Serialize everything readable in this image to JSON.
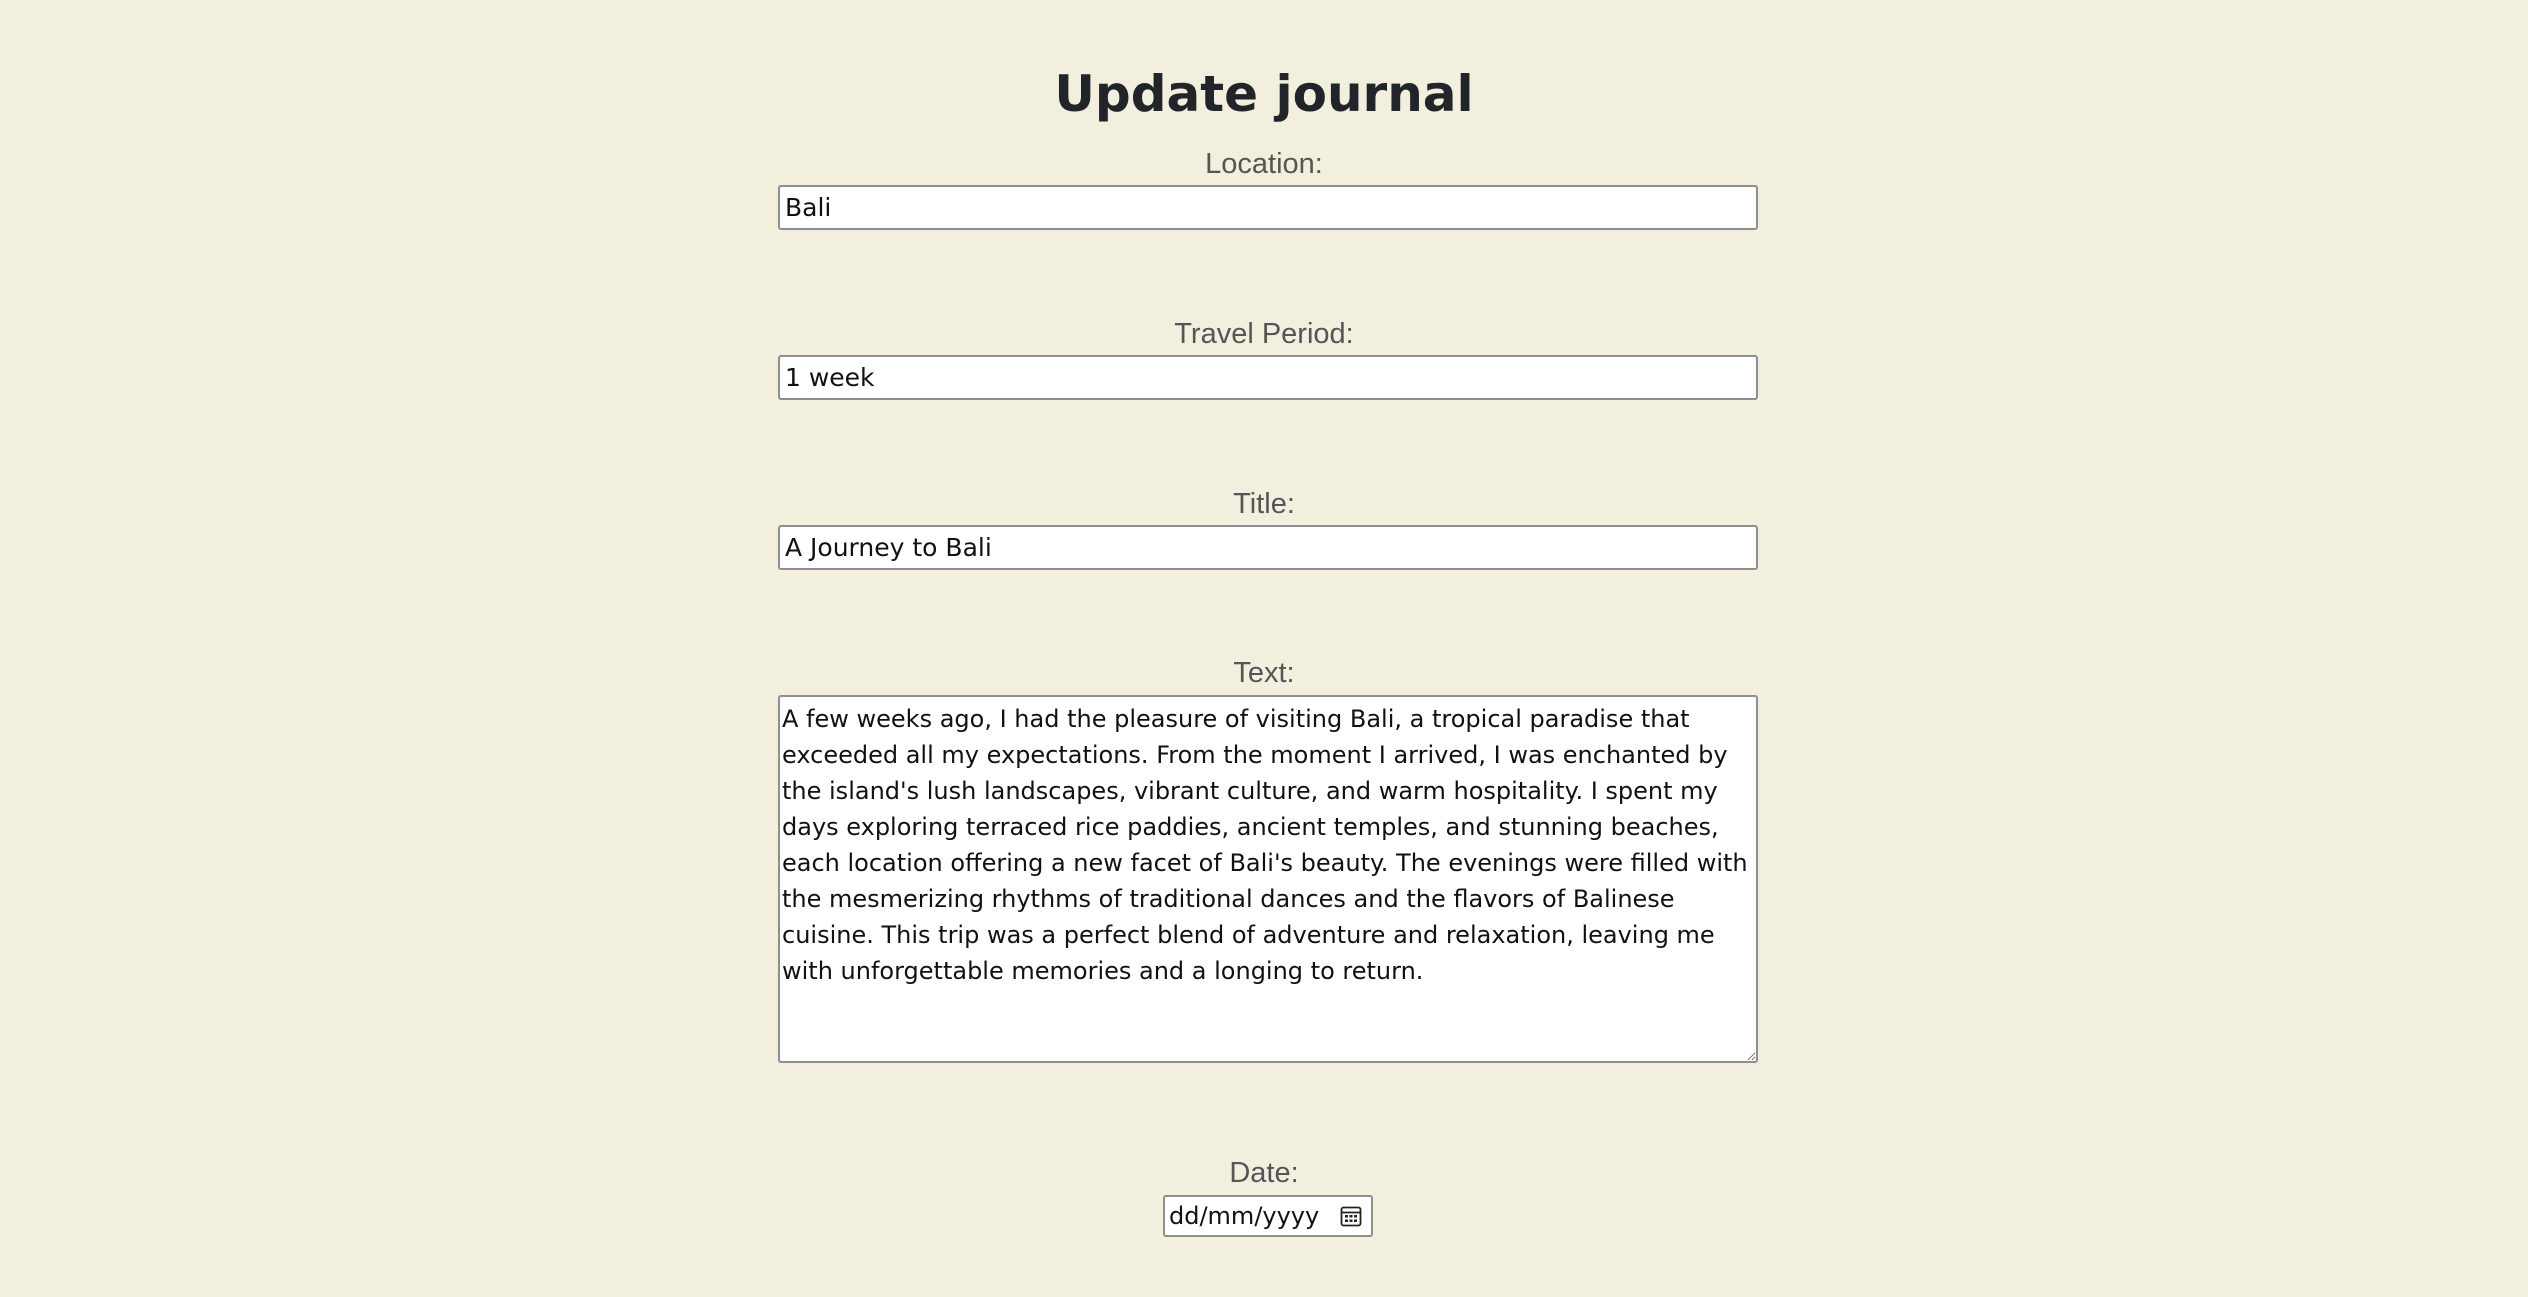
{
  "page": {
    "title": "Update journal",
    "background_color": "#f2efdf"
  },
  "form": {
    "location": {
      "label": "Location:",
      "value": "Bali"
    },
    "travel_period": {
      "label": "Travel Period:",
      "value": "1 week"
    },
    "title": {
      "label": "Title:",
      "value": "A Journey to Bali"
    },
    "text": {
      "label": "Text:",
      "value": "A few weeks ago, I had the pleasure of visiting Bali, a tropical paradise that exceeded all my expectations. From the moment I arrived, I was enchanted by the island's lush landscapes, vibrant culture, and warm hospitality. I spent my days exploring terraced rice paddies, ancient temples, and stunning beaches, each location offering a new facet of Bali's beauty. The evenings were filled with the mesmerizing rhythms of traditional dances and the flavors of Balinese cuisine. This trip was a perfect blend of adventure and relaxation, leaving me with unforgettable memories and a longing to return."
    },
    "date": {
      "label": "Date:",
      "placeholder": "dd/mm/yyyy",
      "icon": "calendar-icon"
    }
  }
}
